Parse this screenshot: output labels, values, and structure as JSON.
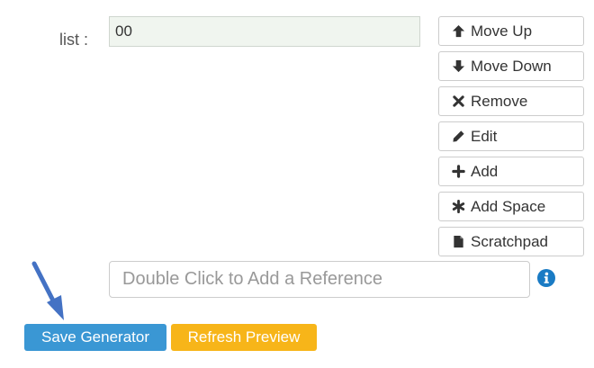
{
  "form": {
    "list_label": "list :",
    "list_items": [
      "00"
    ],
    "reference_placeholder": "Double Click to Add a Reference"
  },
  "side_buttons": {
    "move_up": "Move Up",
    "move_down": "Move Down",
    "remove": "Remove",
    "edit": "Edit",
    "add": "Add",
    "add_space": "Add Space",
    "scratchpad": "Scratchpad"
  },
  "actions": {
    "save_generator": "Save Generator",
    "refresh_preview": "Refresh Preview"
  },
  "icons": {
    "move_up": "arrow-up-icon",
    "move_down": "arrow-down-icon",
    "remove": "close-icon",
    "edit": "pencil-icon",
    "add": "plus-icon",
    "add_space": "asterisk-icon",
    "scratchpad": "file-icon",
    "info": "info-circle-icon",
    "pointer": "blue-arrow-icon"
  },
  "colors": {
    "save_button": "#3a97d4",
    "refresh_button": "#f7b519",
    "info_icon": "#1a7bc4",
    "pointer_arrow": "#4472c4",
    "listbox_bg": "#f0f5ef"
  }
}
